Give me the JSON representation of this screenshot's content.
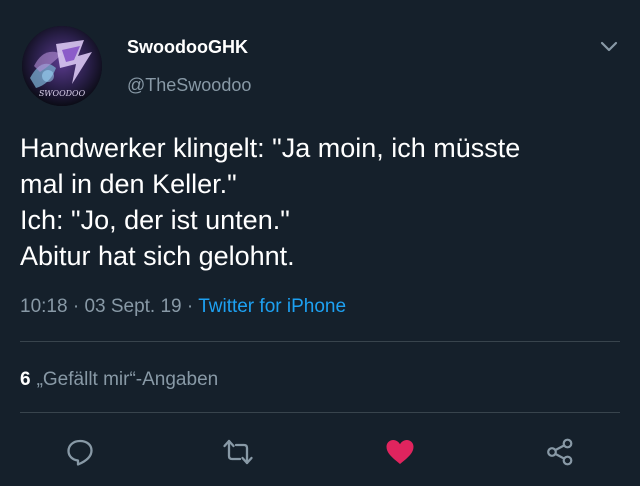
{
  "tweet": {
    "author": {
      "display_name": "SwoodooGHK",
      "handle": "@TheSwoodoo",
      "avatar_text": "SWOODOO"
    },
    "text_lines": [
      "Handwerker klingelt: \"Ja moin, ich müsste",
      "mal in den Keller.\"",
      "Ich: \"Jo, der ist unten.\"",
      "Abitur hat sich gelohnt."
    ],
    "time": "10:18",
    "separator": " · ",
    "date": "03 Sept. 19",
    "source": "Twitter for iPhone",
    "likes": {
      "count": "6",
      "label": "„Gefällt mir“-Angaben"
    }
  },
  "actions": {
    "reply_icon": "reply-icon",
    "retweet_icon": "retweet-icon",
    "like_icon": "heart-icon",
    "share_icon": "share-icon"
  },
  "colors": {
    "background": "#15202b",
    "secondary_text": "#8899a6",
    "link": "#1da1f2",
    "liked": "#e0245e",
    "divider": "#38444d"
  }
}
